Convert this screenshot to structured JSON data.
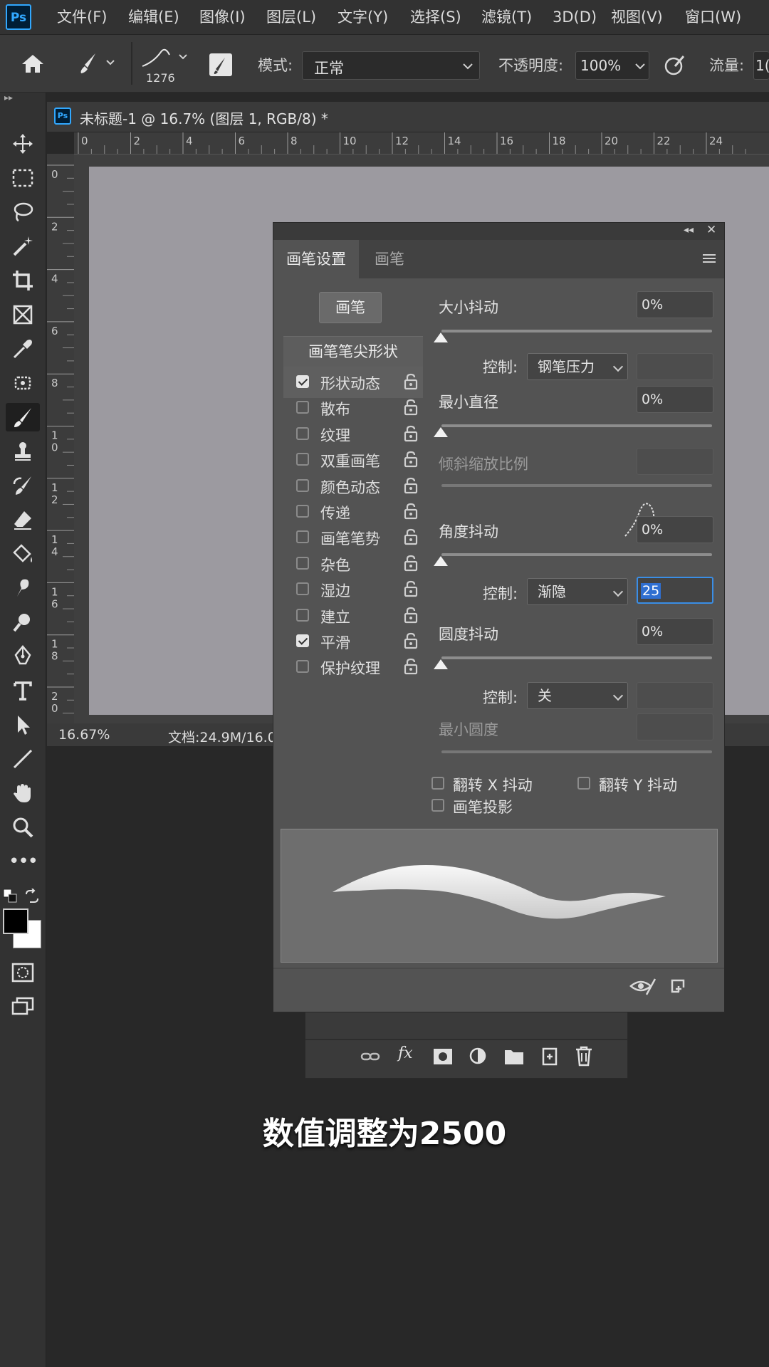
{
  "menubar": {
    "logo": "Ps",
    "items": [
      "文件(F)",
      "编辑(E)",
      "图像(I)",
      "图层(L)",
      "文字(Y)",
      "选择(S)",
      "滤镜(T)",
      "3D(D)",
      "视图(V)",
      "窗口(W)"
    ]
  },
  "options": {
    "brush_size": "1276",
    "mode_label": "模式:",
    "mode_value": "正常",
    "opacity_label": "不透明度:",
    "opacity_value": "100%",
    "flow_label": "流量:",
    "flow_value": "1("
  },
  "document": {
    "tab_title": "未标题-1 @ 16.7% (图层 1, RGB/8) *",
    "ruler_top": [
      "0",
      "2",
      "4",
      "6",
      "8",
      "10",
      "12",
      "14",
      "16",
      "18",
      "20",
      "22",
      "24"
    ],
    "ruler_left": [
      "0",
      "2",
      "4",
      "6",
      "8",
      "1\n0",
      "1\n2",
      "1\n4",
      "1\n6",
      "1\n8",
      "2\n0"
    ],
    "zoom": "16.67%",
    "doc_info": "文档:24.9M/16.0"
  },
  "brush_panel": {
    "tabs": [
      "画笔设置",
      "画笔"
    ],
    "brush_button": "画笔",
    "tip_shape": "画笔笔尖形状",
    "options": [
      {
        "label": "形状动态",
        "checked": true
      },
      {
        "label": "散布",
        "checked": false
      },
      {
        "label": "纹理",
        "checked": false
      },
      {
        "label": "双重画笔",
        "checked": false
      },
      {
        "label": "颜色动态",
        "checked": false
      },
      {
        "label": "传递",
        "checked": false
      },
      {
        "label": "画笔笔势",
        "checked": false
      },
      {
        "label": "杂色",
        "checked": false
      },
      {
        "label": "湿边",
        "checked": false
      },
      {
        "label": "建立",
        "checked": false
      },
      {
        "label": "平滑",
        "checked": true
      },
      {
        "label": "保护纹理",
        "checked": false
      }
    ],
    "size_jitter_label": "大小抖动",
    "size_jitter_value": "0%",
    "control_label": "控制:",
    "control_size": "钢笔压力",
    "min_diameter_label": "最小直径",
    "min_diameter_value": "0%",
    "tilt_scale_label": "倾斜缩放比例",
    "angle_jitter_label": "角度抖动",
    "angle_jitter_value": "0%",
    "control_angle": "渐隐",
    "fade_value": "25",
    "roundness_jitter_label": "圆度抖动",
    "roundness_jitter_value": "0%",
    "control_roundness": "关",
    "min_roundness_label": "最小圆度",
    "flip_x": "翻转 X 抖动",
    "flip_y": "翻转 Y 抖动",
    "brush_projection": "画笔投影"
  },
  "subtitle": "数值调整为2500"
}
